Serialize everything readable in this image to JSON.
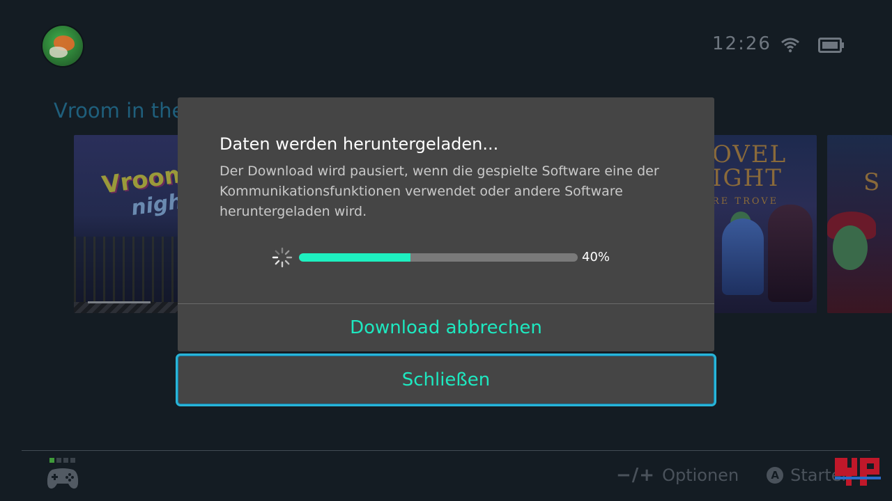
{
  "status_bar": {
    "time": "12:26",
    "wifi_icon": "wifi-icon",
    "battery_icon": "battery-icon"
  },
  "home": {
    "selected_game_title": "Vroom in the",
    "tiles": [
      {
        "name": "vroom-in-the-night-sky",
        "logo_line1": "Vroom",
        "logo_line2": "night"
      },
      {
        "name": "shovel-knight-treasure-trove",
        "line1": "OVEL",
        "line2": "IGHT",
        "line3": "RE TROVE"
      },
      {
        "name": "third-game",
        "line1": "S"
      }
    ]
  },
  "dialog": {
    "title": "Daten werden heruntergeladen...",
    "body": "Der Download wird pausiert, wenn die gespielte Software eine der Kommunikationsfunktionen verwendet oder andere Software heruntergeladen wird.",
    "progress_fraction": 0.4,
    "progress_label": "40%",
    "cancel_label": "Download abbrechen",
    "close_label": "Schließen"
  },
  "footer": {
    "options_symbol": "−/+",
    "options_label": "Optionen",
    "a_button": "A",
    "start_label": "Starten"
  },
  "colors": {
    "accent_teal": "#1ee8c0",
    "focus_border": "#28b5d8",
    "dialog_bg": "#454545",
    "background": "#141c23"
  }
}
